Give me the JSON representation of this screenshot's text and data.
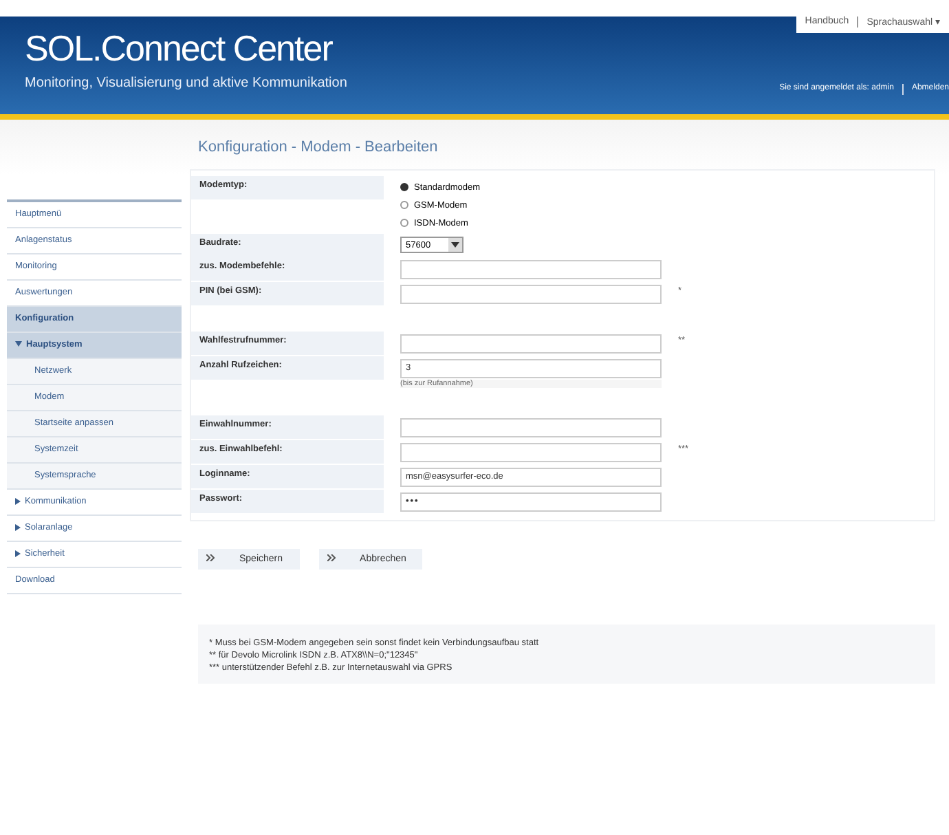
{
  "header": {
    "title": "SOL.Connect Center",
    "subtitle": "Monitoring, Visualisierung und aktive Kommunikation",
    "top_links": [
      "Handbuch",
      "Sprachauswahl ▾"
    ],
    "user_text": "Sie sind angemeldet als: admin",
    "logout": "Abmelden"
  },
  "sidebar": {
    "items": [
      {
        "label": "Hauptmenü",
        "selected": false
      },
      {
        "label": "Anlagenstatus",
        "selected": false
      },
      {
        "label": "Monitoring",
        "selected": false
      },
      {
        "label": "Auswertungen",
        "selected": false
      },
      {
        "label": "Konfiguration",
        "selected": true
      },
      {
        "label": "Hauptsystem",
        "selected": true,
        "expanded": true,
        "children": [
          {
            "label": "Netzwerk",
            "selected": false
          },
          {
            "label": "Modem",
            "selected": false
          },
          {
            "label": "Startseite anpassen",
            "selected": false
          },
          {
            "label": "Systemzeit",
            "selected": false
          },
          {
            "label": "Systemsprache",
            "selected": false
          }
        ]
      },
      {
        "label": "Kommunikation",
        "selected": false,
        "expanded": false
      },
      {
        "label": "Solaranlage",
        "selected": false,
        "expanded": false
      },
      {
        "label": "Sicherheit",
        "selected": false,
        "expanded": false
      },
      {
        "label": "Download",
        "selected": false
      }
    ]
  },
  "page_title": "Konfiguration - Modem - Bearbeiten",
  "form": {
    "groups": [
      [
        {
          "kind": "radio",
          "label": "Modemtyp:",
          "options": [
            {
              "label": "Standardmodem",
              "selected": true
            },
            {
              "label": "GSM-Modem",
              "selected": false
            },
            {
              "label": "ISDN-Modem",
              "selected": false
            }
          ]
        },
        {
          "kind": "select",
          "label": "Baudrate:",
          "value": "57600"
        },
        {
          "kind": "text",
          "label": "zus. Modembefehle:"
        },
        {
          "kind": "text",
          "label": "PIN (bei GSM):",
          "note": "*"
        }
      ],
      [
        {
          "kind": "text",
          "label": "Wahlfestrufnummer:",
          "note": "**"
        },
        {
          "kind": "text",
          "label": "Anzahl Rufzeichen:",
          "value": "3",
          "hint": "(bis zur Rufannahme)"
        }
      ],
      [
        {
          "kind": "text",
          "label": "Einwahlnummer:"
        },
        {
          "kind": "text",
          "label": "zus. Einwahlbefehl:",
          "note": "***"
        },
        {
          "kind": "text",
          "label": "Loginname:",
          "value": "msn@easysurfer-eco.de"
        },
        {
          "kind": "password",
          "label": "Passwort:",
          "value": "•••"
        }
      ]
    ]
  },
  "buttons": [
    "Speichern",
    "Abbrechen"
  ],
  "footnotes": [
    "* Muss bei GSM-Modem angegeben sein sonst findet kein Verbindungsaufbau statt",
    "** für Devolo Microlink ISDN z.B. ATX8\\\\N=0;\"12345\"",
    "*** unterstützender Befehl z.B. zur Internetauswahl via GPRS"
  ]
}
